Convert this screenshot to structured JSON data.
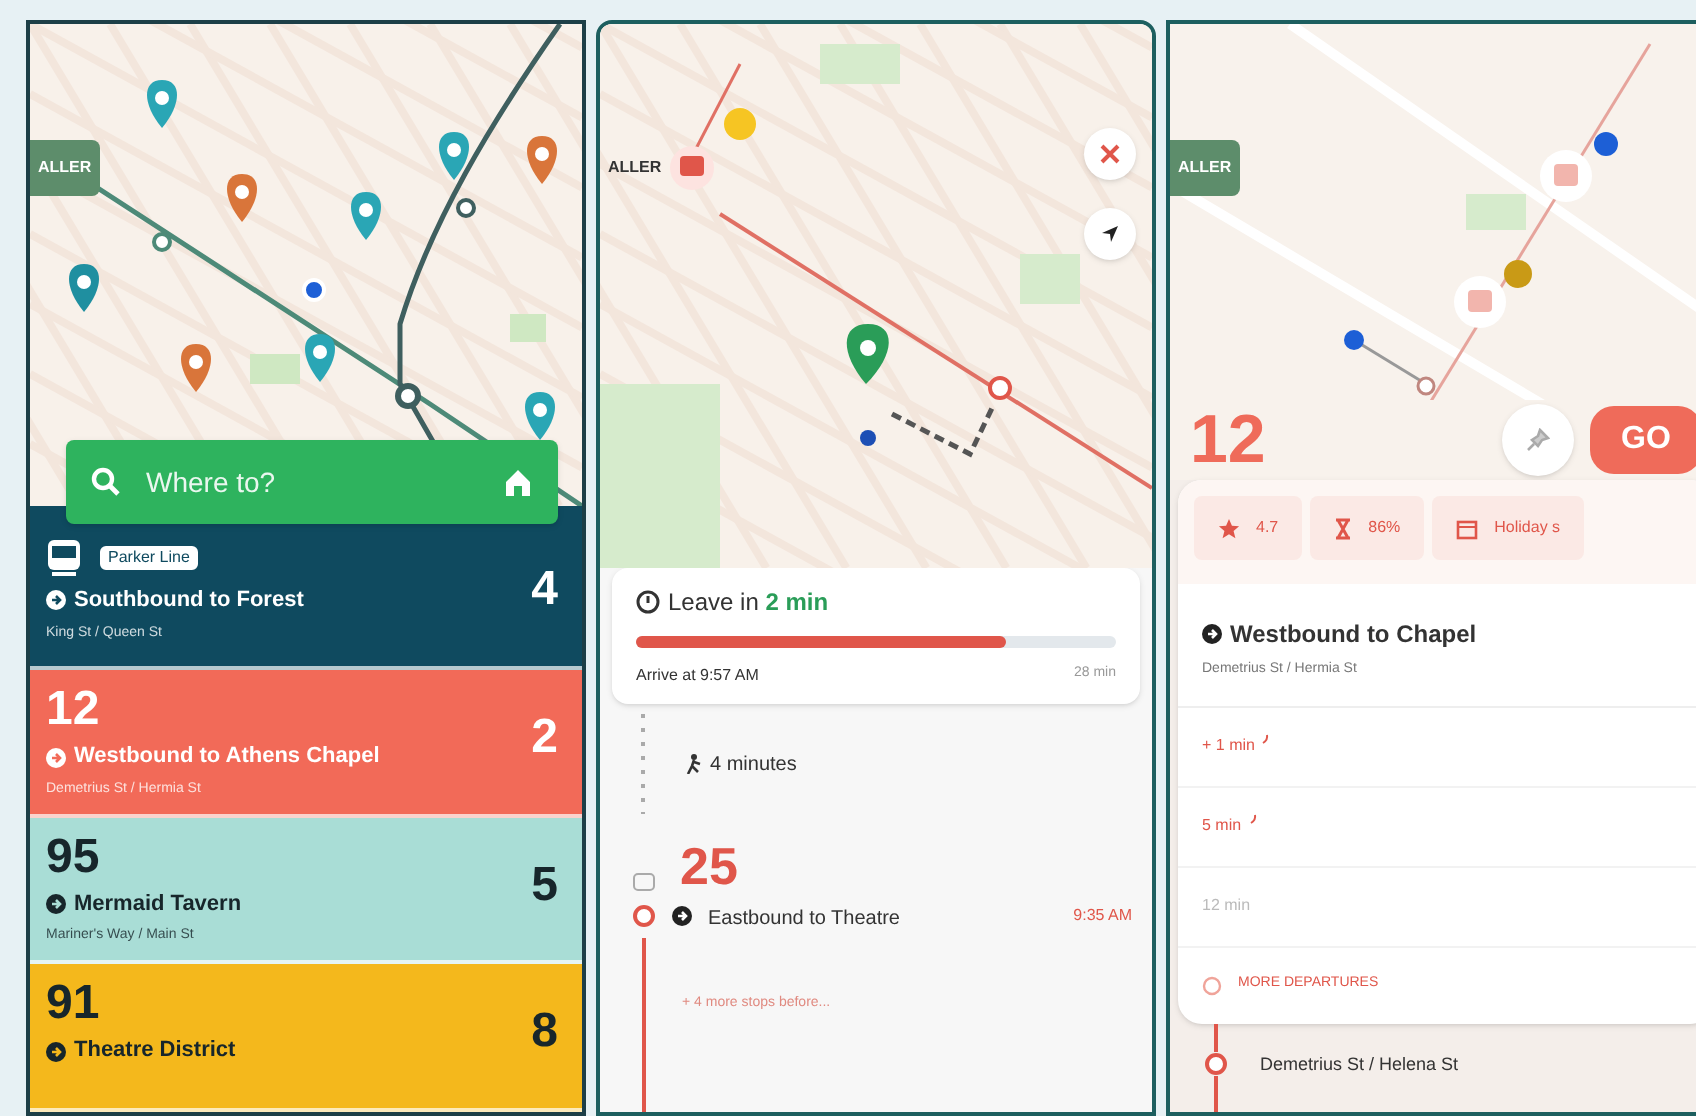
{
  "home_screen": {
    "map_label": "ALLER",
    "search": {
      "placeholder": "Where to?"
    },
    "departures": [
      {
        "kind": "train",
        "badge": "Parker Line",
        "destination": "Southbound to Forest",
        "stop": "King St / Queen St",
        "minutes": "4",
        "color": "#0f4a5f"
      },
      {
        "kind": "bus",
        "route": "12",
        "destination": "Westbound to Athens Chapel",
        "stop": "Demetrius St / Hermia St",
        "minutes": "2",
        "color": "#f26a58"
      },
      {
        "kind": "bus",
        "route": "95",
        "destination": "Mermaid Tavern",
        "stop": "Mariner's Way / Main St",
        "minutes": "5",
        "color": "#a9ddd6"
      },
      {
        "kind": "bus",
        "route": "91",
        "destination": "Theatre District",
        "minutes": "8",
        "color": "#f4b81c"
      }
    ]
  },
  "trip_screen": {
    "map_label": "ALLER",
    "leave_prefix": "Leave in",
    "leave_time": "2 min",
    "progress": {
      "level": 0.77
    },
    "arrive": "Arrive at 9:57 AM",
    "duration": "28 min",
    "walk": "4 minutes",
    "route": "25",
    "destination": "Eastbound to Theatre",
    "time": "9:35 AM",
    "more_stops": "+ 4 more stops before..."
  },
  "route_screen": {
    "map_label": "ALLER",
    "route": "12",
    "go": "GO",
    "stats": [
      {
        "kind": "rating",
        "value": "4.7"
      },
      {
        "kind": "crowding",
        "value": "86%"
      },
      {
        "kind": "calendar",
        "value": "Holiday s"
      }
    ],
    "direction": "Westbound to Chapel",
    "stop": "Demetrius St / Hermia St",
    "departures": [
      {
        "time": "+ 1 min",
        "live": true
      },
      {
        "time": "5 min",
        "live": true
      },
      {
        "time": "12 min",
        "live": false
      }
    ],
    "more": "MORE DEPARTURES",
    "next_stop": "Demetrius St / Helena St"
  }
}
